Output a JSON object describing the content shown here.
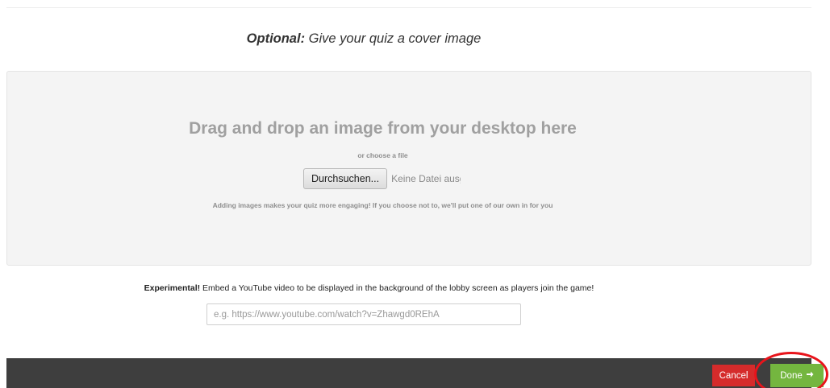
{
  "cover": {
    "heading_bold": "Optional:",
    "heading_rest": " Give your quiz a cover image"
  },
  "dropzone": {
    "title": "Drag and drop an image from your desktop here",
    "subtitle": "or choose a file",
    "browse_label": "Durchsuchen...",
    "file_status": "Keine Datei ausgewählt.",
    "hint": "Adding images makes your quiz more engaging! If you choose not to, we'll put one of our own in for you"
  },
  "experimental": {
    "label_bold": "Experimental!",
    "label_rest": " Embed a YouTube video to be displayed in the background of the lobby screen as players join the game!",
    "input_placeholder": "e.g. https://www.youtube.com/watch?v=Zhawgd0REhA",
    "input_value": ""
  },
  "footer": {
    "cancel_label": "Cancel",
    "done_label": "Done",
    "done_icon": "arrow-right-icon"
  },
  "colors": {
    "footer_bg": "#3e3e3e",
    "cancel": "#d52b2b",
    "done": "#74b63f",
    "highlight": "#e8141b"
  }
}
